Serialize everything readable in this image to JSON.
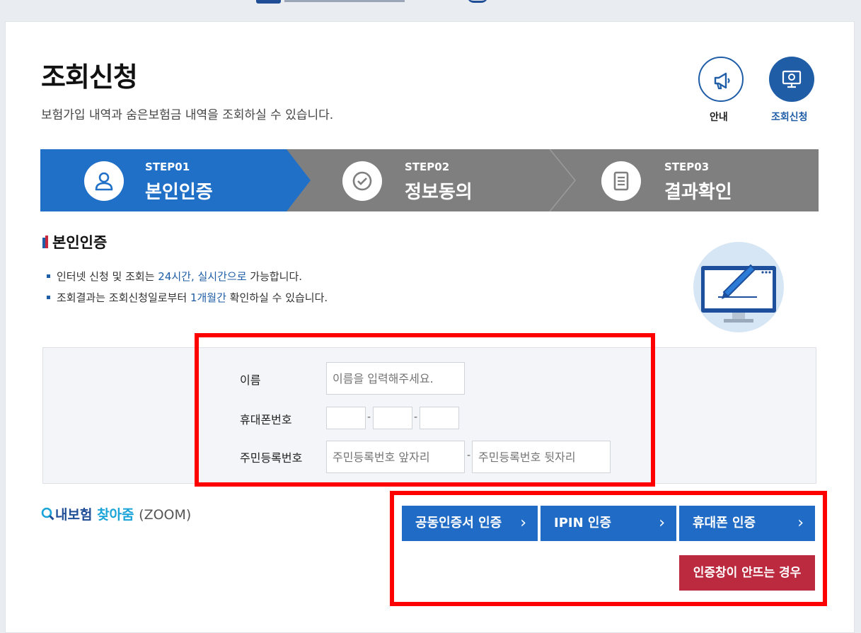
{
  "page": {
    "title": "조회신청",
    "subtitle": "보험가입 내역과 숨은보험금 내역을 조회하실 수 있습니다."
  },
  "top_icons": [
    {
      "label": "안내",
      "icon": "megaphone-icon"
    },
    {
      "label": "조회신청",
      "icon": "monitor-search-icon"
    }
  ],
  "steps": [
    {
      "num": "STEP01",
      "name": "본인인증",
      "icon": "user-icon",
      "active": true
    },
    {
      "num": "STEP02",
      "name": "정보동의",
      "icon": "check-circle-icon",
      "active": false
    },
    {
      "num": "STEP03",
      "name": "결과확인",
      "icon": "document-icon",
      "active": false
    }
  ],
  "section": {
    "title": "본인인증",
    "bullet1": {
      "pre": "인터넷 신청 및 조회는 ",
      "hl": "24시간, 실시간으로",
      "post": " 가능합니다."
    },
    "bullet2": {
      "pre": "조회결과는 조회신청일로부터 ",
      "hl": "1개월간",
      "post": " 확인하실 수 있습니다."
    }
  },
  "form": {
    "name_label": "이름",
    "name_placeholder": "이름을 입력해주세요.",
    "phone_label": "휴대폰번호",
    "dash": "-",
    "rrn_label": "주민등록번호",
    "rrn_front_placeholder": "주민등록번호 앞자리",
    "rrn_back_placeholder": "주민등록번호 뒷자리"
  },
  "zoom": {
    "part1": "내보험",
    "part2": "찾아줌",
    "part3": "(ZOOM)"
  },
  "auth_buttons": {
    "cert": "공동인증서 인증",
    "ipin": "IPIN 인증",
    "phone": "휴대폰 인증",
    "chevron": "›"
  },
  "warn_button": "인증창이 안뜨는 경우",
  "colors": {
    "primary": "#1f6bc5",
    "step_active": "#2170c8",
    "step_inactive": "#7f7f7f",
    "warn": "#bb2a3f",
    "highlight": "#ff0000"
  }
}
